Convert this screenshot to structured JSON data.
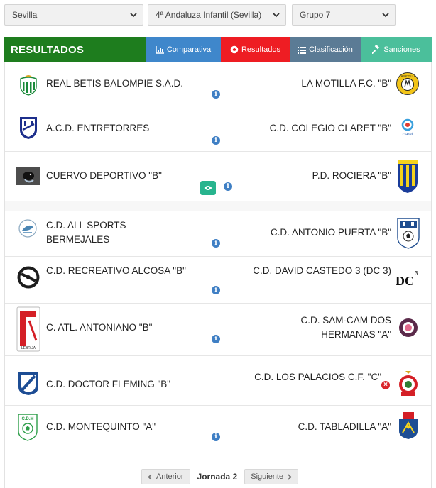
{
  "filters": {
    "region": "Sevilla",
    "competition": "4ª Andaluza Infantil (Sevilla)",
    "group": "Grupo 7"
  },
  "header": {
    "title": "RESULTADOS",
    "tabs": {
      "comparativa": "Comparativa",
      "resultados": "Resultados",
      "clasificacion": "Clasificación",
      "sanciones": "Sanciones"
    }
  },
  "matches": [
    {
      "home": "REAL BETIS BALOMPIE S.A.D.",
      "away": "LA MOTILLA F.C. \"B\""
    },
    {
      "home": "A.C.D. ENTRETORRES",
      "away": "C.D. COLEGIO CLARET \"B\""
    },
    {
      "home": "CUERVO DEPORTIVO \"B\"",
      "away": "P.D. ROCIERA \"B\""
    },
    {
      "home": "C.D. ALL SPORTS BERMEJALES",
      "away": "C.D. ANTONIO PUERTA \"B\""
    },
    {
      "home": "C.D. RECREATIVO ALCOSA \"B\"",
      "away": "C.D. DAVID CASTEDO 3 (DC 3)"
    },
    {
      "home": "C. ATL. ANTONIANO \"B\"",
      "away": "C.D. SAM-CAM DOS HERMANAS \"A\""
    },
    {
      "home": "C.D. DOCTOR FLEMING \"B\"",
      "away": "C.D. LOS PALACIOS C.F. \"C\""
    },
    {
      "home": "C.D. MONTEQUINTO \"A\"",
      "away": "C.D. TABLADILLA \"A\""
    }
  ],
  "logos": {
    "motilla": "LA MOTILLA",
    "claret": "claret",
    "dc3": "DC",
    "dc3_sup": "3",
    "antoniano": "LEBRIJA",
    "montequinto": "C.D.M"
  },
  "icons": {
    "info": "i",
    "cancel": "×"
  },
  "pagination": {
    "prev": "Anterior",
    "current": "Jornada 2",
    "next": "Siguiente"
  },
  "colors": {
    "header_green": "#1e7d1e",
    "comparativa": "#3f87cb",
    "resultados": "#ee1d23",
    "clasificacion": "#5b7b95",
    "sanciones": "#4bbf9b",
    "info_blue": "#3f7fc4"
  }
}
